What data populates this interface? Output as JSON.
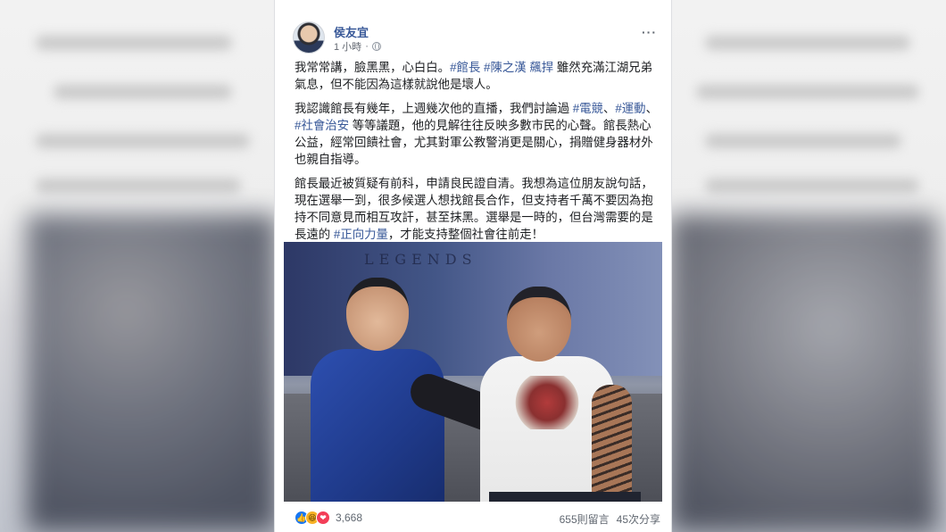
{
  "post": {
    "author": "侯友宜",
    "time": "1 小時",
    "more_label": "···",
    "paragraphs": [
      [
        {
          "t": "我常常講，臉黑黑，心白白。",
          "tag": false
        },
        {
          "t": "#館長",
          "tag": true
        },
        {
          "t": " ",
          "tag": false
        },
        {
          "t": "#陳之漢",
          "tag": true
        },
        {
          "t": " ",
          "tag": false
        },
        {
          "t": "飆捍",
          "tag": true
        },
        {
          "t": " 雖然充滿江湖兄弟氣息，但不能因為這樣就說他是壞人。",
          "tag": false
        }
      ],
      [
        {
          "t": "我認識館長有幾年，上週幾次他的直播，我們討論過 ",
          "tag": false
        },
        {
          "t": "#電競",
          "tag": true
        },
        {
          "t": "、",
          "tag": false
        },
        {
          "t": "#運動",
          "tag": true
        },
        {
          "t": "、",
          "tag": false
        },
        {
          "t": "#社會治安",
          "tag": true
        },
        {
          "t": " 等等議題，他的見解往往反映多數市民的心聲。館長熱心公益，經常回饋社會，尤其對軍公教警消更是關心，捐贈健身器材外也親自指導。",
          "tag": false
        }
      ],
      [
        {
          "t": "館長最近被質疑有前科，申請良民證自清。我想為這位朋友說句話，現在選舉一到，很多候選人想找館長合作，但支持者千萬不要因為抱持不同意見而相互攻訐，甚至抹黑。選舉是一時的，但台灣需要的是長遠的 ",
          "tag": false
        },
        {
          "t": "#正向力量",
          "tag": true
        },
        {
          "t": "，才能支持整個社會往前走！",
          "tag": false
        }
      ]
    ],
    "photo_wall_text": "LEGENDS",
    "reactions": {
      "icons": [
        "👍",
        "😆",
        "❤"
      ],
      "count": "3,668"
    },
    "comments": "655則留言",
    "shares": "45次分享"
  },
  "colors": {
    "link": "#385898",
    "text": "#1c1e21",
    "meta": "#616770"
  }
}
